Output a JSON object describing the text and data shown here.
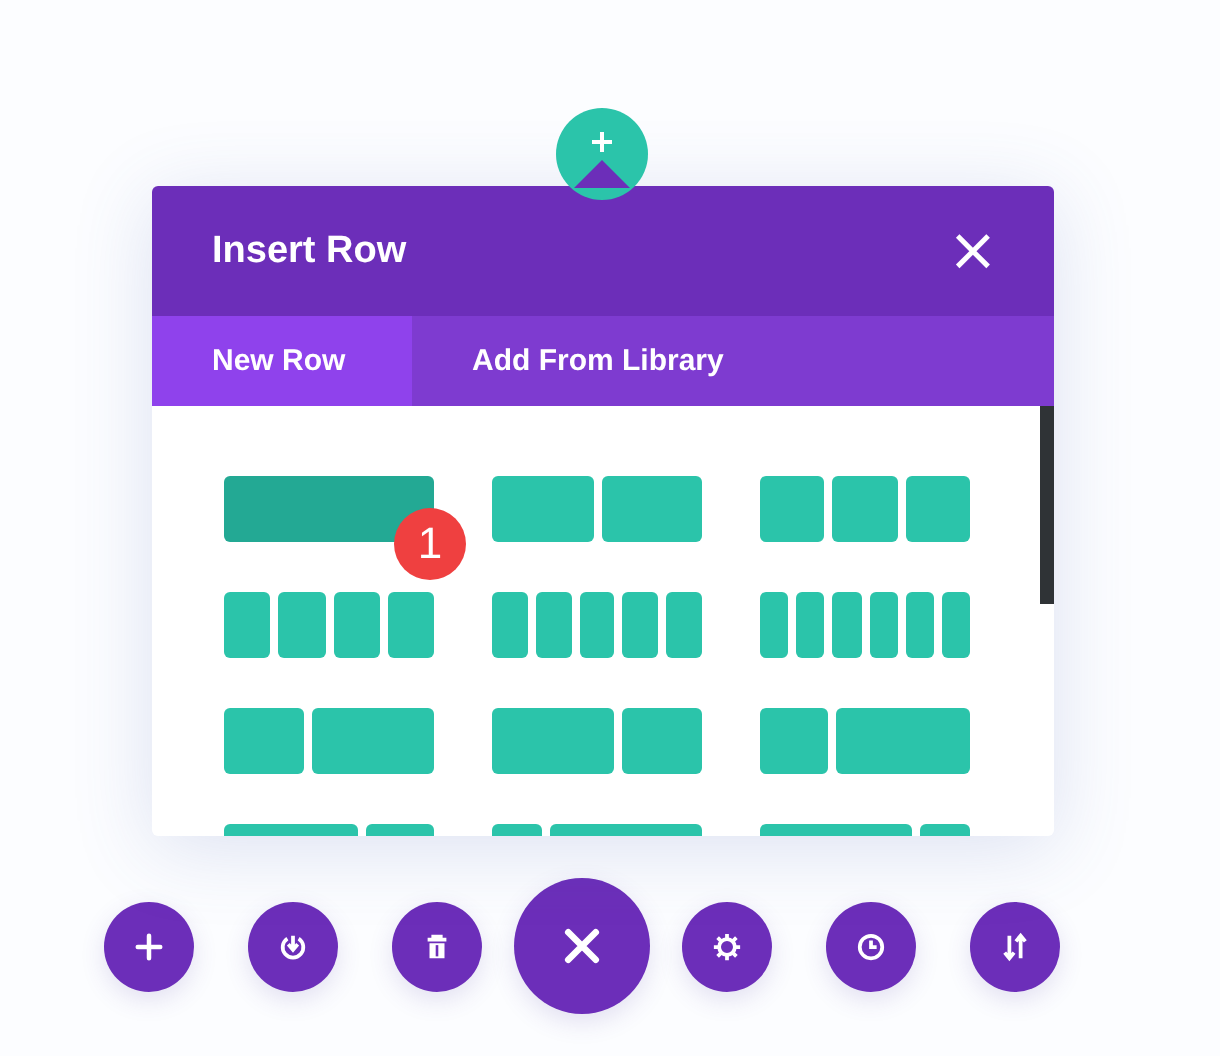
{
  "dialog": {
    "title": "Insert Row",
    "close": "×"
  },
  "tabs": [
    {
      "label": "New Row",
      "selected": true
    },
    {
      "label": "Add From Library",
      "selected": false
    }
  ],
  "layouts": [
    {
      "kind": "full",
      "selected": true,
      "badge": "1"
    },
    {
      "kind": "halves",
      "selected": false
    },
    {
      "kind": "thirds",
      "selected": false
    },
    {
      "kind": "quarters",
      "selected": false
    },
    {
      "kind": "fifths",
      "selected": false
    },
    {
      "kind": "sixths",
      "selected": false
    },
    {
      "kind": "narrowwide",
      "selected": false
    },
    {
      "kind": "widenarrow",
      "selected": false
    },
    {
      "kind": "slimwide",
      "selected": false
    },
    {
      "kind": "wideslim",
      "selected": false
    },
    {
      "kind": "tinywide",
      "selected": false
    },
    {
      "kind": "widetiny",
      "selected": false
    }
  ],
  "toolbar": [
    {
      "kind": "add"
    },
    {
      "kind": "load"
    },
    {
      "kind": "delete"
    },
    {
      "kind": "close"
    },
    {
      "kind": "settings"
    },
    {
      "kind": "history"
    },
    {
      "kind": "sort"
    }
  ]
}
